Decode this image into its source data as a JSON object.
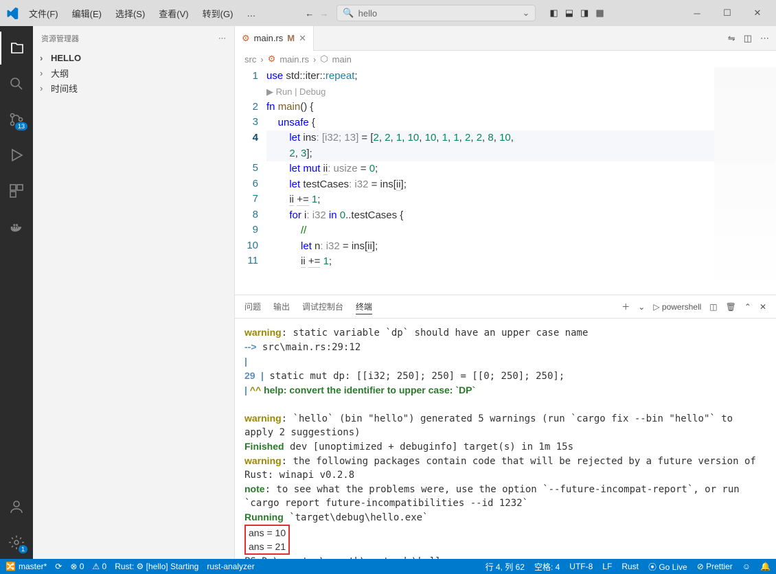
{
  "titlebar": {
    "menus": [
      "文件(F)",
      "编辑(E)",
      "选择(S)",
      "查看(V)",
      "转到(G)",
      "…"
    ],
    "search_placeholder": "hello"
  },
  "activity": {
    "scm_badge": "13",
    "settings_badge": "1"
  },
  "sidebar": {
    "title": "资源管理器",
    "items": [
      "HELLO",
      "大纲",
      "时间线"
    ]
  },
  "tab": {
    "icon": "⚙",
    "name": "main.rs",
    "modified": "M"
  },
  "breadcrumb": {
    "parts": [
      "src",
      "main.rs",
      "main"
    ]
  },
  "code": {
    "line_numbers": [
      "1",
      "2",
      "3",
      "4",
      "5",
      "6",
      "7",
      "8",
      "9",
      "10",
      "11"
    ],
    "hint": "▶ Run | Debug",
    "lines_html": [
      "<span class='kw'>use</span> std::iter::<span class='ty'>repeat</span>;",
      "<span class='kw'>fn</span> <span class='fn'>main</span>() {",
      "    <span class='kw'>unsafe</span> {",
      "        <span class='kw'>let</span> ins<span class='inl'>: [i32; 13]</span> = [<span class='num'>2</span>, <span class='num'>2</span>, <span class='num'>1</span>, <span class='num'>10</span>, <span class='num'>10</span>, <span class='num'>1</span>, <span class='num'>1</span>, <span class='num'>2</span>, <span class='num'>2</span>, <span class='num'>8</span>, <span class='num'>10</span>,\n        <span class='num'>2</span>, <span class='num'>3</span>];",
      "        <span class='kw'>let</span> <span class='kw'>mut</span> <span class='hl'>ii</span><span class='inl'>: usize</span> = <span class='num'>0</span>;",
      "        <span class='kw'>let</span> testCases<span class='inl'>: i32</span> = ins[<span class='hl'>ii</span>];",
      "        <span class='hl'>ii</span> <span class='hl'>+=</span> <span class='num'>1</span>;",
      "        <span class='kw'>for</span> i<span class='inl'>: i32</span> <span class='kw'>in</span> <span class='num'>0</span>..testCases {",
      "            <span class='cm'>//</span>",
      "            <span class='kw'>let</span> n<span class='inl'>: i32</span> = ins[<span class='hl'>ii</span>];",
      "            <span class='hl'>ii</span> <span class='hl'>+=</span> <span class='num'>1</span>;"
    ]
  },
  "panel": {
    "tabs": [
      "问题",
      "输出",
      "调试控制台",
      "终端"
    ],
    "shell": "powershell",
    "terminal_lines": {
      "l1a": "warning",
      "l1b": ": static variable `dp` should have an upper case name",
      "l2a": "  -->",
      "l2b": " src\\main.rs:29:12",
      "l3": "29",
      "l3b": " static mut dp: [[i32; 250]; 250] = [[0; 250]; 250];",
      "l4a": "            ^^ ",
      "l4b": "help: convert the identifier to upper case: `DP`",
      "l5a": "warning",
      "l5b": ": `hello` (bin \"hello\") generated 5 warnings (run `cargo fix --bin \"hello\"` to apply 2 suggestions)",
      "l6a": "    Finished",
      "l6b": " dev [unoptimized + debuginfo] target(s) in 1m 15s",
      "l7a": "warning",
      "l7b": ": the following packages contain code that will be rejected by a future version of Rust: winapi v0.2.8",
      "l8a": "note",
      "l8b": ": to see what the problems were, use the option `--future-incompat-report`, or run `cargo report future-incompatibilities --id 1232`",
      "l9a": "     Running",
      "l9b": " `target\\debug\\hello.exe`",
      "ans1": "ans = 10",
      "ans2": "ans = 21",
      "prompt": "PS D:\\mysetup\\gopath\\rustcode\\hello> "
    }
  },
  "status": {
    "branch": "master*",
    "sync": "⟳",
    "errors": "⊗ 0",
    "warnings": "⚠ 0",
    "rust_ext": "Rust: ⚙ [hello] Starting",
    "rust_analyzer": "rust-analyzer",
    "position": "行 4, 列 62",
    "spaces": "空格: 4",
    "encoding": "UTF-8",
    "eol": "LF",
    "lang": "Rust",
    "golive": "⦿ Go Live",
    "prettier": "⊘ Prettier",
    "feedback": "☺",
    "bell": "🔔"
  }
}
